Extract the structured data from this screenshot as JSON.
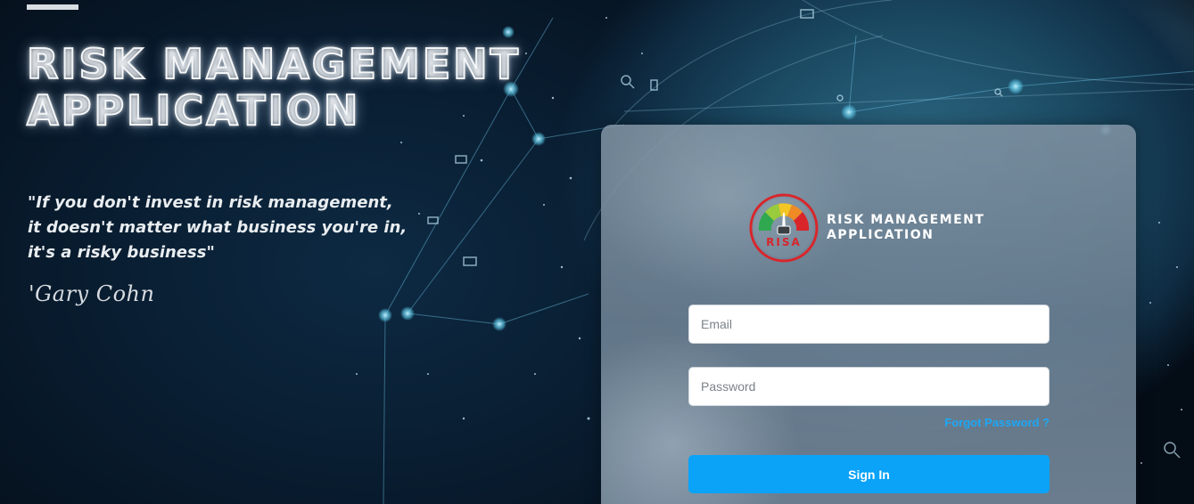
{
  "hero": {
    "title": "RISK MANAGEMENT\nAPPLICATION",
    "quote": "\"If you don't invest in risk management,\nit doesn't matter what business you're in,\nit's a risky business\"",
    "author": "'Gary Cohn"
  },
  "login": {
    "brand_name": "RISK MANAGEMENT\nAPPLICATION",
    "brand_logo_text": "RISA",
    "email_placeholder": "Email",
    "password_placeholder": "Password",
    "forgot_password": "Forgot Password ?",
    "sign_in": "Sign In"
  },
  "colors": {
    "accent": "#0ba3f8",
    "link": "#1ea7f5",
    "gauge_green": "#2fa84f",
    "gauge_yellow": "#f3c623",
    "gauge_red": "#d8262b"
  }
}
